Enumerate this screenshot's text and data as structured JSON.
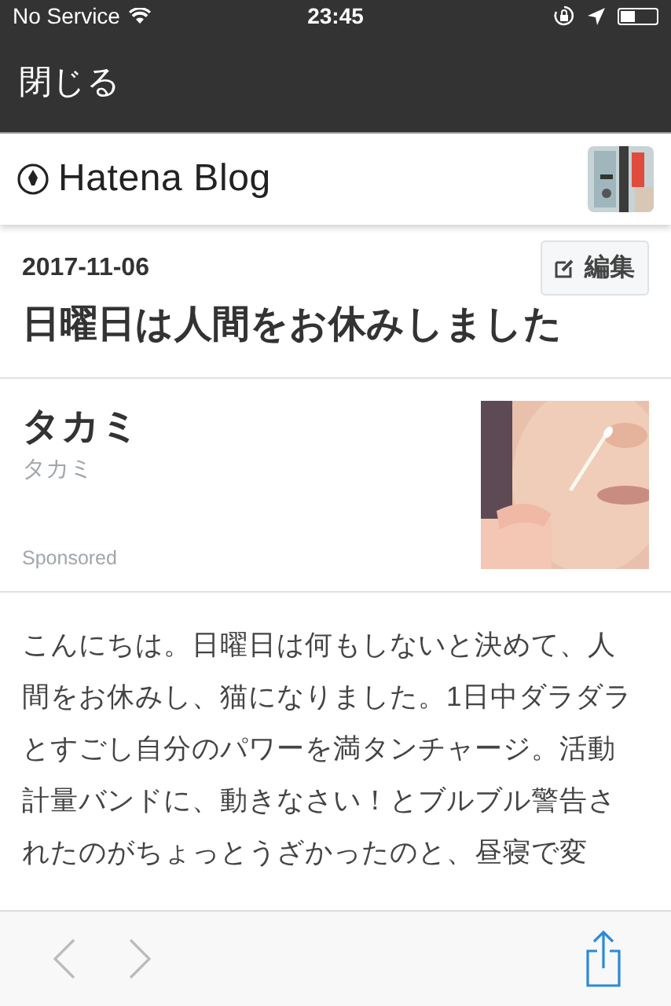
{
  "status_bar": {
    "carrier": "No Service",
    "time": "23:45"
  },
  "nav_bar": {
    "close_label": "閉じる"
  },
  "blog_header": {
    "logo_text": "Hatena Blog"
  },
  "article": {
    "date": "2017-11-06",
    "edit_label": "編集",
    "title": "日曜日は人間をお休みしました"
  },
  "ad": {
    "title": "タカミ",
    "subtitle": "タカミ",
    "label": "Sponsored"
  },
  "body": "こんにちは。日曜日は何もしないと決めて、人間をお休みし、猫になりました。1日中ダラダラとすごし自分のパワーを満タンチャージ。活動計量バンドに、動きなさい！とブルブル警告されたのがちょっとうざかったのと、昼寝で変",
  "toolbar": {
    "back_disabled": true,
    "forward_disabled": true
  }
}
